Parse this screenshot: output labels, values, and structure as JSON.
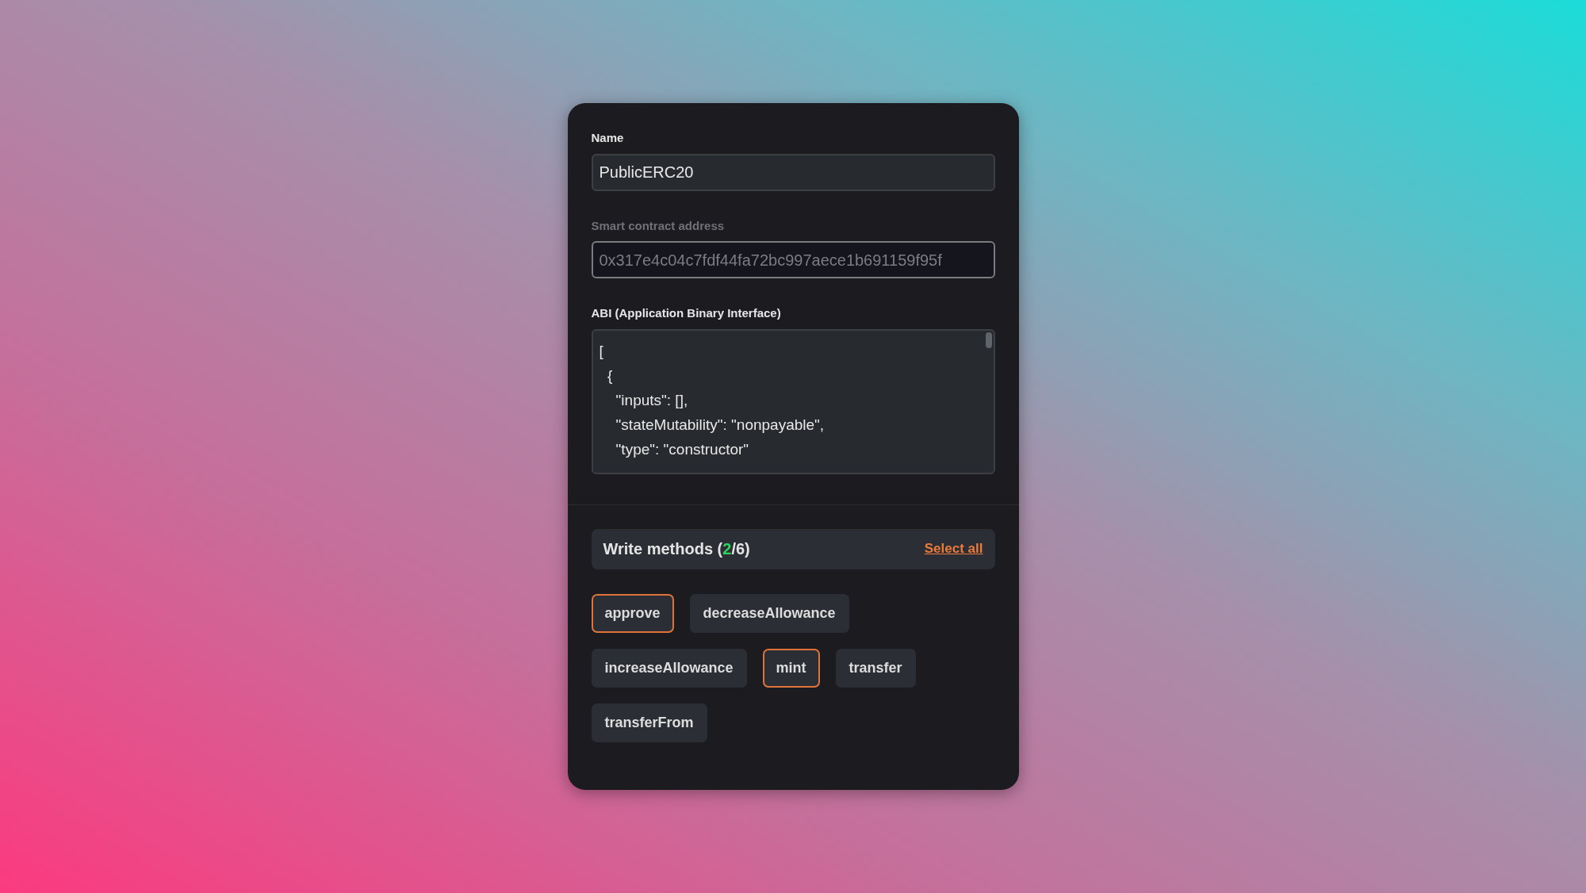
{
  "fields": [
    {
      "kind": "input",
      "label": "Name",
      "value": "PublicERC20",
      "disabled": false
    },
    {
      "kind": "input",
      "label": "Smart contract address",
      "value": "0x317e4c04c7fdf44fa72bc997aece1b691159f95f",
      "disabled": true
    },
    {
      "kind": "code",
      "label": "ABI (Application Binary Interface)",
      "lines": [
        "[",
        "  {",
        "    \"inputs\": [],",
        "    \"stateMutability\": \"nonpayable\",",
        "    \"type\": \"constructor\""
      ],
      "disabled": false
    }
  ],
  "methods_header": {
    "title_parts": [
      {
        "kind": "plain",
        "text": "Write methods ("
      },
      {
        "kind": "count",
        "text": "2"
      },
      {
        "kind": "plain",
        "text": "/6)"
      }
    ],
    "link": "Select all"
  },
  "methods": [
    {
      "label": "approve",
      "selected": true
    },
    {
      "label": "decreaseAllowance",
      "selected": false
    },
    {
      "label": "increaseAllowance",
      "selected": false
    },
    {
      "label": "mint",
      "selected": true
    },
    {
      "label": "transfer",
      "selected": false
    },
    {
      "label": "transferFrom",
      "selected": false
    }
  ]
}
